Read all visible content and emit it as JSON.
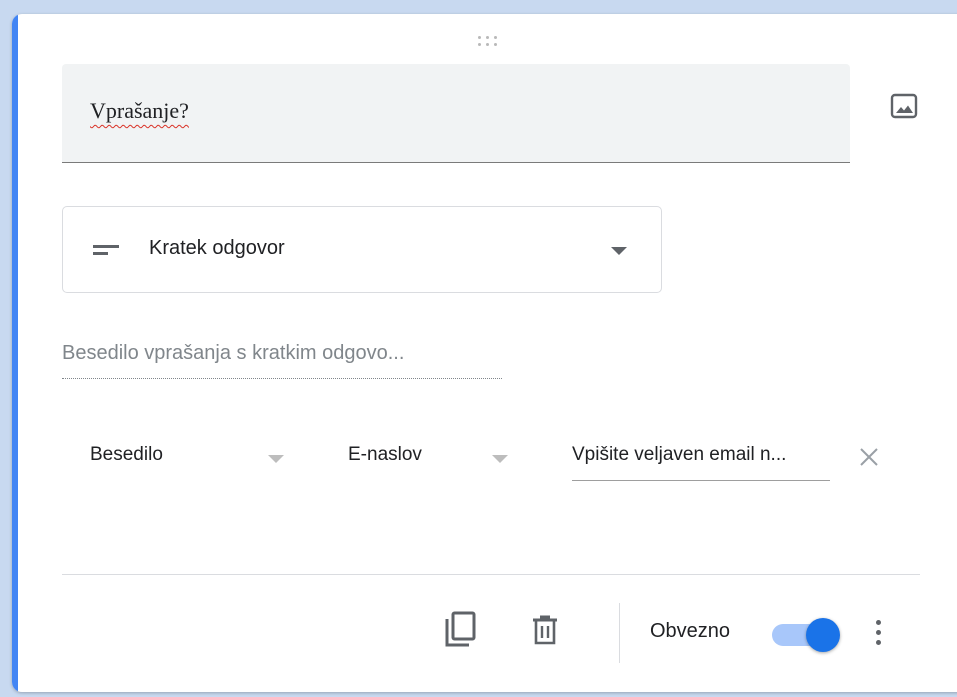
{
  "question": {
    "title": "Vprašanje?"
  },
  "question_type": {
    "selected": "Kratek odgovor",
    "icon": "short-text-icon"
  },
  "description": {
    "placeholder": "Besedilo vprašanja s kratkim odgovo..."
  },
  "validation": {
    "type": "Besedilo",
    "condition": "E-naslov",
    "error_text": "Vpišite veljaven email n..."
  },
  "footer": {
    "required_label": "Obvezno",
    "required_on": true
  },
  "colors": {
    "accent": "#4285f4",
    "toggle_knob": "#1a73e8",
    "toggle_track": "#a8c7fa",
    "spellcheck": "#d93025"
  },
  "icons": {
    "image": "image-icon",
    "copy": "copy-icon",
    "delete": "trash-icon",
    "more": "more-vert-icon",
    "clear": "close-icon",
    "drag": "drag-handle-icon"
  }
}
